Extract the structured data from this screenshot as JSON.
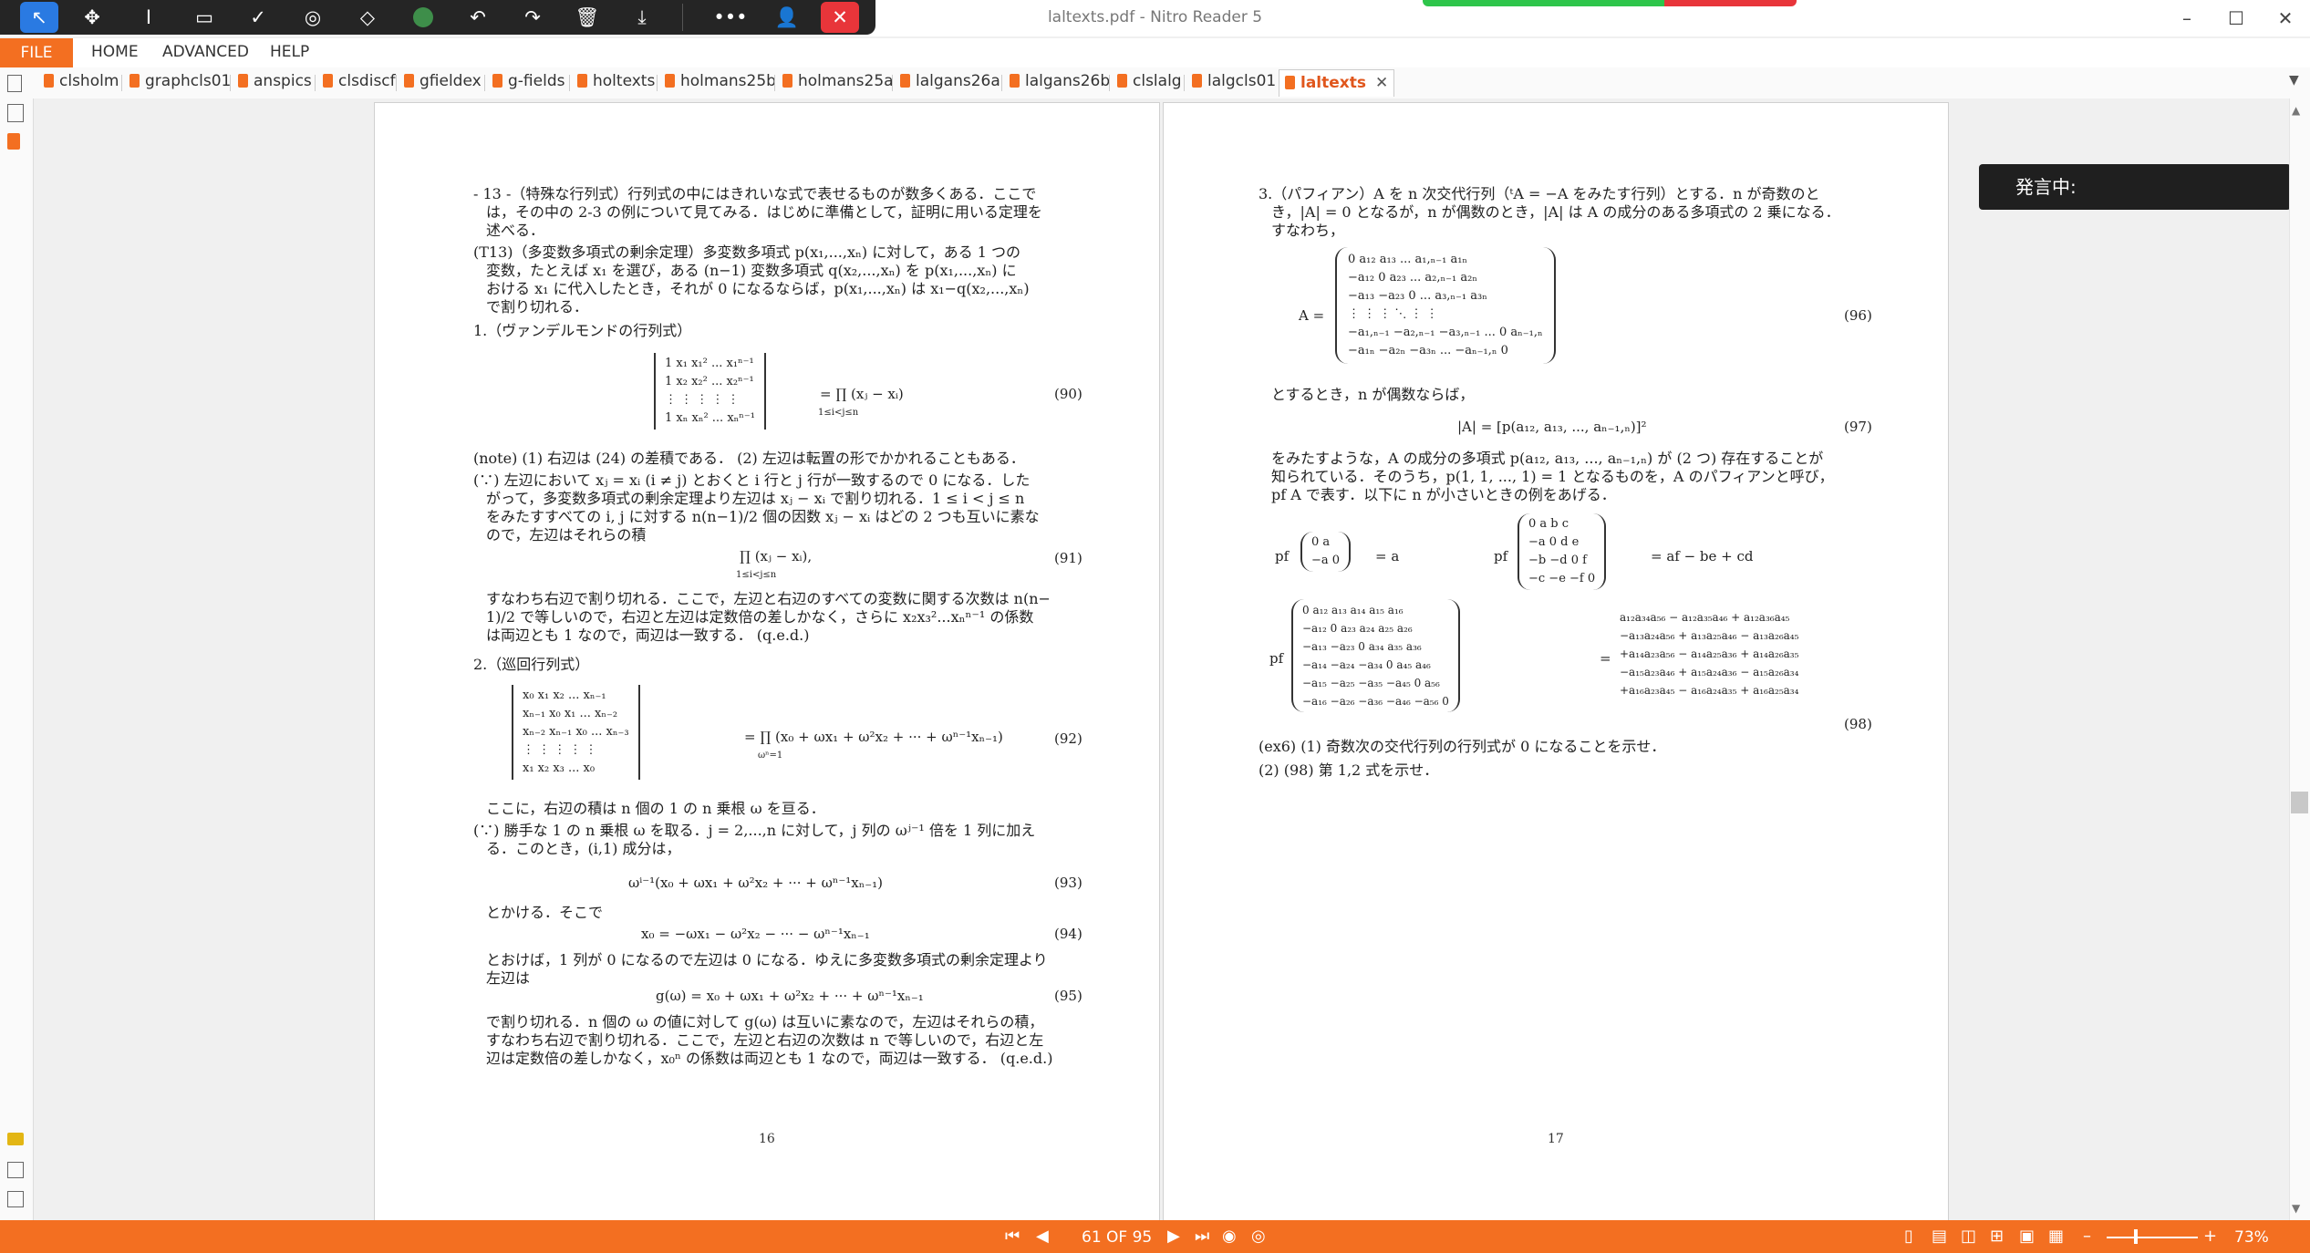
{
  "window": {
    "title": "laltexts.pdf - Nitro Reader 5",
    "minimize": "–",
    "maximize": "☐",
    "close": "✕"
  },
  "quick_toolbar": {
    "icons": [
      "select-icon",
      "pan-icon",
      "text-select-icon",
      "crop-icon",
      "check-icon",
      "stamp-icon",
      "eraser-icon",
      "color-icon",
      "undo-icon",
      "redo-icon",
      "delete-icon",
      "download-icon",
      "more-icon",
      "user-icon",
      "close-icon"
    ]
  },
  "menu": {
    "file": "FILE",
    "home": "HOME",
    "advanced": "ADVANCED",
    "help": "HELP"
  },
  "tabs": [
    {
      "label": "clsholm"
    },
    {
      "label": "graphcls01"
    },
    {
      "label": "anspics"
    },
    {
      "label": "clsdiscf"
    },
    {
      "label": "gfieldex"
    },
    {
      "label": "g-fields"
    },
    {
      "label": "holtexts"
    },
    {
      "label": "holmans25b"
    },
    {
      "label": "holmans25a"
    },
    {
      "label": "lalgans26a"
    },
    {
      "label": "lalgans26b"
    },
    {
      "label": "clslalg"
    },
    {
      "label": "lalgcls01"
    },
    {
      "label": "laltexts",
      "active": true
    }
  ],
  "overlay": {
    "speaking": "発言中:"
  },
  "status": {
    "page_indicator": "61 OF 95",
    "zoom": "73%",
    "zoom_minus": "–",
    "zoom_plus": "+"
  },
  "page16": {
    "p1a": "- 13 -（特殊な行列式）行列式の中にはきれいな式で表せるものが数多くある．ここで",
    "p1b": "は，その中の 2-3 の例について見てみる．はじめに準備として，証明に用いる定理を",
    "p1c": "述べる．",
    "p2a": "(T13)（多変数多項式の剰余定理）多変数多項式 p(x₁,...,xₙ) に対して，ある 1 つの",
    "p2b": "変数，たとえば x₁ を選び，ある (n−1) 変数多項式 q(x₂,...,xₙ) を p(x₁,...,xₙ) に",
    "p2c": "おける x₁ に代入したとき，それが 0 になるならば，p(x₁,...,xₙ) は x₁−q(x₂,...,xₙ)",
    "p2d": "で割り切れる．",
    "s1": "1.（ヴァンデルモンドの行列式）",
    "vdm_rows": [
      "1   x₁   x₁²   ...   x₁ⁿ⁻¹",
      "1   x₂   x₂²   ...   x₂ⁿ⁻¹",
      "⋮    ⋮     ⋮     ⋮      ⋮",
      "1   xₙ   xₙ²   ...   xₙⁿ⁻¹"
    ],
    "vdm_rhs": "= ∏ (xⱼ − xᵢ)",
    "vdm_sub": "1≤i<j≤n",
    "eq90": "(90)",
    "note": "(note) (1) 右辺は (24) の差積である． (2) 左辺は転置の形でかかれることもある．",
    "p3a": "(∵) 左辺において xⱼ = xᵢ (i ≠ j) とおくと i 行と j 行が一致するので 0 になる．した",
    "p3b": "がって，多変数多項式の剰余定理より左辺は xⱼ − xᵢ で割り切れる．1 ≤ i < j ≤ n",
    "p3c": "をみたすすべての i, j に対する n(n−1)/2 個の因数 xⱼ − xᵢ はどの 2 つも互いに素な",
    "p3d": "ので，左辺はそれらの積",
    "eq91_expr": "∏ (xⱼ − xᵢ),",
    "eq91_sub": "1≤i<j≤n",
    "eq91": "(91)",
    "p4a": "すなわち右辺で割り切れる．ここで，左辺と右辺のすべての変数に関する次数は n(n−",
    "p4b": "1)/2 で等しいので，右辺と左辺は定数倍の差しかなく，さらに x₂x₃²...xₙⁿ⁻¹ の係数",
    "p4c": "は両辺とも 1 なので，両辺は一致する． (q.e.d.)",
    "s2": "2.（巡回行列式）",
    "circ_rows": [
      "x₀      x₁     x₂    ...   xₙ₋₁",
      "xₙ₋₁   x₀     x₁    ...   xₙ₋₂",
      "xₙ₋₂   xₙ₋₁  x₀    ...   xₙ₋₃",
      "⋮        ⋮       ⋮      ⋮       ⋮",
      "x₁      x₂     x₃    ...   x₀"
    ],
    "circ_rhs": "= ∏ (x₀ + ωx₁ + ω²x₂ + ··· + ωⁿ⁻¹xₙ₋₁)",
    "circ_sub": "ωⁿ=1",
    "eq92": "(92)",
    "p5": "ここに，右辺の積は n 個の 1 の n 乗根 ω を亘る．",
    "p6a": "(∵) 勝手な 1 の n 乗根 ω を取る．j = 2,...,n に対して，j 列の ωʲ⁻¹ 倍を 1 列に加え",
    "p6b": "る．このとき，(i,1) 成分は，",
    "eq93_expr": "ωⁱ⁻¹(x₀ + ωx₁ + ω²x₂ + ··· + ωⁿ⁻¹xₙ₋₁)",
    "eq93": "(93)",
    "p7": "とかける．そこで",
    "eq94_expr": "x₀ = −ωx₁ − ω²x₂ − ··· − ωⁿ⁻¹xₙ₋₁",
    "eq94": "(94)",
    "p8a": "とおけば，1 列が 0 になるので左辺は 0 になる．ゆえに多変数多項式の剰余定理より",
    "p8b": "左辺は",
    "eq95_expr": "g(ω) = x₀ + ωx₁ + ω²x₂ + ··· + ωⁿ⁻¹xₙ₋₁",
    "eq95": "(95)",
    "p9a": "で割り切れる．n 個の ω の値に対して g(ω) は互いに素なので，左辺はそれらの積，",
    "p9b": "すなわち右辺で割り切れる．ここで，左辺と右辺の次数は n で等しいので，右辺と左",
    "p9c": "辺は定数倍の差しかなく，x₀ⁿ の係数は両辺とも 1 なので，両辺は一致する． (q.e.d.)",
    "page_number": "16"
  },
  "page17": {
    "p1a": "3.（パフィアン）A を n 次交代行列（ᵗA = −A をみたす行列）とする．n が奇数のと",
    "p1b": "き，|A| = 0 となるが，n が偶数のとき，|A| は A の成分のある多項式の 2 乗になる．",
    "p1c": "すなわち，",
    "A_label": "A =",
    "A_rows": [
      "0           a₁₂         a₁₃        ...    a₁,ₙ₋₁       a₁ₙ",
      "−a₁₂         0          a₂₃        ...    a₂,ₙ₋₁       a₂ₙ",
      "−a₁₃       −a₂₃         0         ...    a₃,ₙ₋₁       a₃ₙ",
      "⋮             ⋮            ⋮          ⋱        ⋮             ⋮",
      "−a₁,ₙ₋₁   −a₂,ₙ₋₁   −a₃,ₙ₋₁   ...       0         aₙ₋₁,ₙ",
      "−a₁ₙ       −a₂ₙ       −a₃ₙ      ...   −aₙ₋₁,ₙ       0"
    ],
    "eq96": "(96)",
    "p2": "とするとき，n が偶数ならば，",
    "eq97_expr": "|A| = [p(a₁₂, a₁₃, ..., aₙ₋₁,ₙ)]²",
    "eq97": "(97)",
    "p3a": "をみたすような，A の成分の多項式 p(a₁₂, a₁₃, ..., aₙ₋₁,ₙ) が (2 つ) 存在することが",
    "p3b": "知られている．そのうち，p(1, 1, ..., 1) = 1 となるものを，A のパフィアンと呼び，",
    "p3c": "pf A で表す．以下に n が小さいときの例をあげる．",
    "pf_label": "pf",
    "pf2_rows": [
      "0     a",
      "−a    0"
    ],
    "pf2_rhs": "= a",
    "pf4_rows": [
      "0     a     b    c",
      "−a    0     d    e",
      "−b   −d     0    f",
      "−c   −e   −f    0"
    ],
    "pf4_rhs": "= af − be + cd",
    "pf6_rows": [
      "0      a₁₂    a₁₃    a₁₄    a₁₅    a₁₆",
      "−a₁₂     0     a₂₃    a₂₄    a₂₅    a₂₆",
      "−a₁₃   −a₂₃     0     a₃₄    a₃₅    a₃₆",
      "−a₁₄   −a₂₄   −a₃₄     0     a₄₅    a₄₆",
      "−a₁₅   −a₂₅   −a₃₅   −a₄₅     0     a₅₆",
      "−a₁₆   −a₂₆   −a₃₆   −a₄₆   −a₅₆     0"
    ],
    "pf6_eq": "=",
    "pf6_rhs": [
      "a₁₂a₃₄a₅₆ − a₁₂a₃₅a₄₆ + a₁₂a₃₆a₄₅",
      "−a₁₃a₂₄a₅₆ + a₁₃a₂₅a₄₆ − a₁₃a₂₆a₄₅",
      "+a₁₄a₂₃a₅₆ − a₁₄a₂₅a₃₆ + a₁₄a₂₆a₃₅",
      "−a₁₅a₂₃a₄₆ + a₁₅a₂₄a₃₆ − a₁₅a₂₆a₃₄",
      "+a₁₆a₂₃a₄₅ − a₁₆a₂₄a₃₅ + a₁₆a₂₅a₃₄"
    ],
    "eq98": "(98)",
    "ex6a": "(ex6) (1) 奇数次の交代行列の行列式が 0 になることを示せ．",
    "ex6b": "(2) (98) 第 1,2 式を示せ．",
    "page_number": "17"
  }
}
